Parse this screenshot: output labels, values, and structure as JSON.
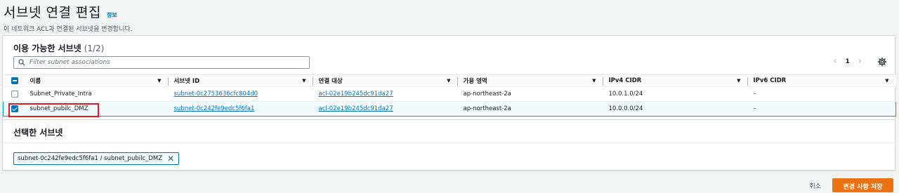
{
  "header": {
    "title": "서브넷 연결 편집",
    "info": "정보",
    "description": "이 네트워크 ACL과 연결된 서브넷을 변경합니다."
  },
  "available": {
    "title": "이용 가능한 서브넷",
    "count": "(1/2)",
    "filter_placeholder": "Filter subnet associations",
    "page": "1",
    "columns": [
      "이름",
      "서브넷 ID",
      "연결 대상",
      "가용 영역",
      "IPv4 CIDR",
      "IPv6 CIDR"
    ],
    "rows": [
      {
        "name": "Subnet_Private_Intra",
        "subnet_id": "subnet-0c2753636cfc804d0",
        "associated": "acl-02e19b245dc91da27",
        "az": "ap-northeast-2a",
        "ipv4": "10.0.1.0/24",
        "ipv6": "–",
        "checked": false
      },
      {
        "name": "subnet_pubilc_DMZ",
        "subnet_id": "subnet-0c242fe9edc5f6fa1",
        "associated": "acl-02e19b245dc91da27",
        "az": "ap-northeast-2a",
        "ipv4": "10.0.0.0/24",
        "ipv6": "–",
        "checked": true
      }
    ]
  },
  "selected": {
    "title": "선택한 서브넷",
    "token": "subnet-0c242fe9edc5f6fa1 / subnet_pubilc_DMZ"
  },
  "footer": {
    "cancel": "취소",
    "save": "변경 사항 저장"
  },
  "colors": {
    "accent": "#0073bb",
    "primary_button": "#ec7211",
    "highlight": "#e21c1c"
  }
}
